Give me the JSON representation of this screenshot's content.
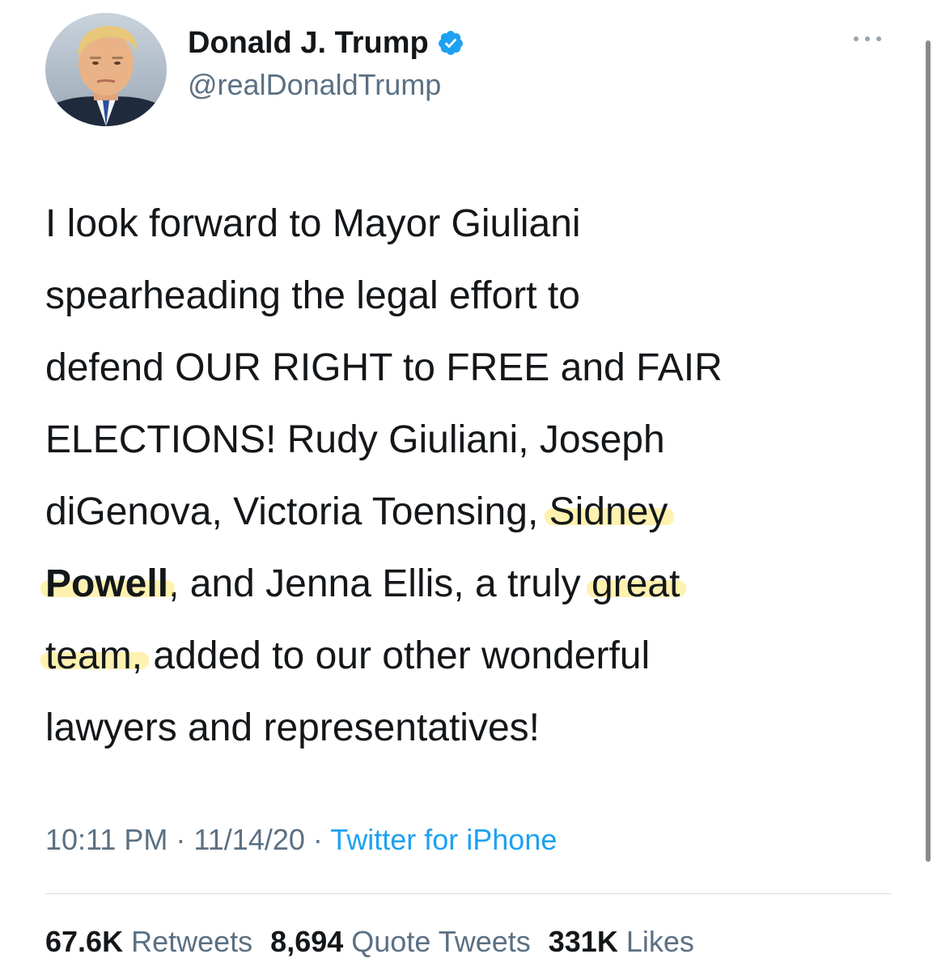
{
  "author": {
    "display_name": "Donald J. Trump",
    "handle": "@realDonaldTrump",
    "verified": true,
    "avatar_icon": "profile-photo"
  },
  "tweet": {
    "lines": [
      "I look forward to Mayor Giuliani",
      "spearheading the legal effort to",
      "defend OUR RIGHT to FREE and FAIR",
      "ELECTIONS! Rudy Giuliani, Joseph",
      "diGenova, Victoria Toensing, ",
      "Sidney",
      "Powell",
      ", and Jenna Ellis, a truly ",
      "great",
      "team,",
      " added to our other wonderful",
      "lawyers and representatives!"
    ],
    "highlight_color": "#ffe66e"
  },
  "meta": {
    "time": "10:11 PM",
    "date": "11/14/20",
    "separator": " · ",
    "source": "Twitter for iPhone",
    "source_color": "#1da1f2"
  },
  "stats": {
    "retweets_count": "67.6K",
    "retweets_label": "Retweets",
    "quotes_count": "8,694",
    "quotes_label": "Quote Tweets",
    "likes_count": "331K",
    "likes_label": "Likes"
  },
  "icons": {
    "verified": "verified-badge-icon",
    "more": "more-dots-icon"
  }
}
